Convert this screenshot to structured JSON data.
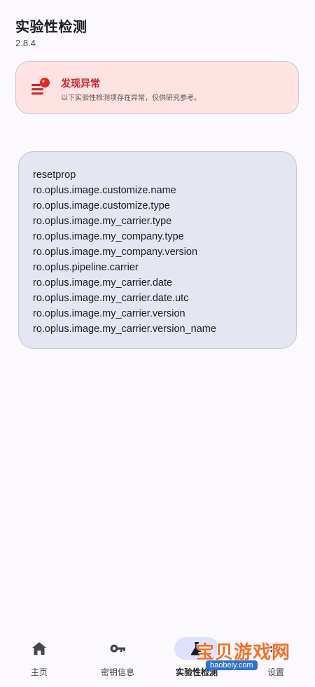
{
  "header": {
    "title": "实验性检测",
    "version": "2.8.4"
  },
  "alert": {
    "title": "发现异常",
    "description": "以下实验性检测项存在异常，仅供研究参考。",
    "icon": "warning-list-icon",
    "accent_color": "#c7262b",
    "background_color": "#ffe3e2"
  },
  "detections": {
    "items": [
      "resetprop",
      "ro.oplus.image.customize.name",
      "ro.oplus.image.customize.type",
      "ro.oplus.image.my_carrier.type",
      "ro.oplus.image.my_company.type",
      "ro.oplus.image.my_company.version",
      "ro.oplus.pipeline.carrier",
      "ro.oplus.image.my_carrier.date",
      "ro.oplus.image.my_carrier.date.utc",
      "ro.oplus.image.my_carrier.version",
      "ro.oplus.image.my_carrier.version_name"
    ]
  },
  "nav": {
    "items": [
      {
        "label": "主页",
        "icon": "home-icon"
      },
      {
        "label": "密钥信息",
        "icon": "key-icon"
      },
      {
        "label": "实验性检测",
        "icon": "flask-icon",
        "active": true
      },
      {
        "label": "设置",
        "icon": "gear-icon"
      }
    ]
  },
  "watermark": {
    "text": "宝贝游戏网",
    "url": "baobeiy.com"
  }
}
